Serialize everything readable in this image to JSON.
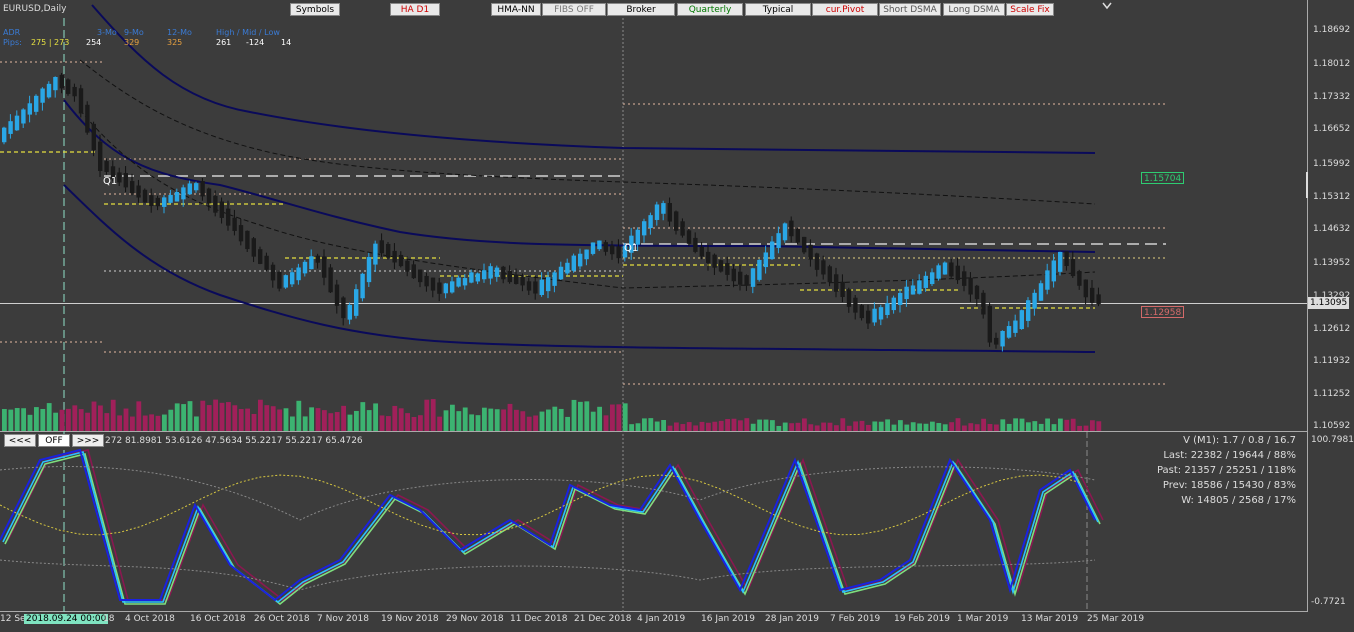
{
  "chart": {
    "title": "EURUSD,Daily",
    "toolbar": [
      {
        "label": "Symbols",
        "color": "#000000",
        "bg": "#e9e9e9"
      },
      {
        "label": "HA D1",
        "color": "#cc0000",
        "bg": "#e9e9e9"
      },
      {
        "label": "HMA-NN",
        "color": "#000000",
        "bg": "#e9e9e9"
      },
      {
        "label": "FIBS OFF",
        "color": "#777777",
        "bg": "#e9e9e9"
      },
      {
        "label": "Broker",
        "color": "#000000",
        "bg": "#e9e9e9"
      },
      {
        "label": "Quarterly",
        "color": "#007700",
        "bg": "#e9e9e9"
      },
      {
        "label": "Typical",
        "color": "#000000",
        "bg": "#e9e9e9"
      },
      {
        "label": "cur.Pivot",
        "color": "#cc0000",
        "bg": "#e9e9e9"
      },
      {
        "label": "Short DSMA",
        "color": "#555555",
        "bg": "#e9e9e9"
      },
      {
        "label": "Long DSMA",
        "color": "#555555",
        "bg": "#e9e9e9"
      },
      {
        "label": "Scale Fix",
        "color": "#cc0000",
        "bg": "#e9e9e9"
      }
    ],
    "stats": {
      "row1": {
        "a": "ADR",
        "b": "3-Mo",
        "c": "6-Mo",
        "d": "9-Mo",
        "e": "12-Mo",
        "f": "High / Mid / Low"
      },
      "row2": {
        "label": "Pips:",
        "v1": "275 | 273",
        "v2": "254",
        "v3": "329",
        "v4": "325",
        "v5": "261",
        "v6": "-124",
        "v7": "14"
      }
    },
    "markers": {
      "q1_left": "Q1",
      "q1_mid": "Q1"
    },
    "price_tags": {
      "green": "1.15704",
      "current": "1.13095",
      "red": "1.12958"
    },
    "y_axis": [
      "1.18692",
      "1.18012",
      "1.17332",
      "1.16652",
      "1.15992",
      "1.15312",
      "1.14632",
      "1.13952",
      "1.13292",
      "1.12612",
      "1.11932",
      "1.11252",
      "1.10592"
    ],
    "x_axis": [
      "12 Se",
      "2018.09.24 00:00",
      "18",
      "4 Oct 2018",
      "16 Oct 2018",
      "26 Oct 2018",
      "7 Nov 2018",
      "19 Nov 2018",
      "29 Nov 2018",
      "11 Dec 2018",
      "21 Dec 2018",
      "4 Jan 2019",
      "16 Jan 2019",
      "28 Jan 2019",
      "7 Feb 2019",
      "19 Feb 2019",
      "1 Mar 2019",
      "13 Mar 2019",
      "25 Mar 2019"
    ]
  },
  "oscillator": {
    "nav": {
      "prev": "<<<",
      "off": "OFF",
      "next": ">>>"
    },
    "values_text": "272 81.8981 53.6126 47.5634 55.2217 55.2217 65.4726",
    "max_label": "100.7981",
    "min_label": "-0.7721",
    "rows": [
      "V (M1): 1.7 / 0.8 / 16.7",
      "Last: 22382 / 19644 / 88%",
      "Past: 21357 / 25251 / 118%",
      "Prev: 18586 / 15430 / 83%",
      "W: 14805 / 2568 / 17%"
    ]
  },
  "colors": {
    "bull": "#2aa7e6",
    "bear": "#1a1a1a",
    "vol_up": "#3cb371",
    "vol_dn": "#a0205a",
    "band": "#0a0a5a",
    "bg": "#3c3c3c"
  }
}
